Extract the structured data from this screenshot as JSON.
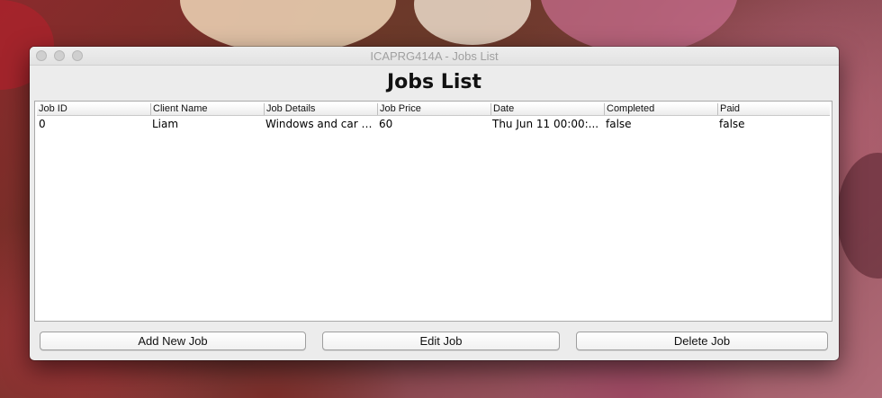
{
  "window": {
    "title": "ICAPRG414A - Jobs List"
  },
  "page": {
    "heading": "Jobs List"
  },
  "table": {
    "columns": [
      "Job ID",
      "Client Name",
      "Job Details",
      "Job Price",
      "Date",
      "Completed",
      "Paid"
    ],
    "rows": [
      [
        "0",
        "Liam",
        "Windows and car n...",
        "60",
        "Thu Jun 11 00:00:...",
        "false",
        "false"
      ]
    ]
  },
  "buttons": {
    "add": "Add New Job",
    "edit": "Edit Job",
    "delete": "Delete Job"
  },
  "icons": {
    "close": "close-dot-icon",
    "minimize": "minimize-dot-icon",
    "zoom": "zoom-dot-icon"
  },
  "colors": {
    "window_bg": "#ececec",
    "table_bg": "#ffffff",
    "traffic_inactive": "#cfcfcf"
  }
}
